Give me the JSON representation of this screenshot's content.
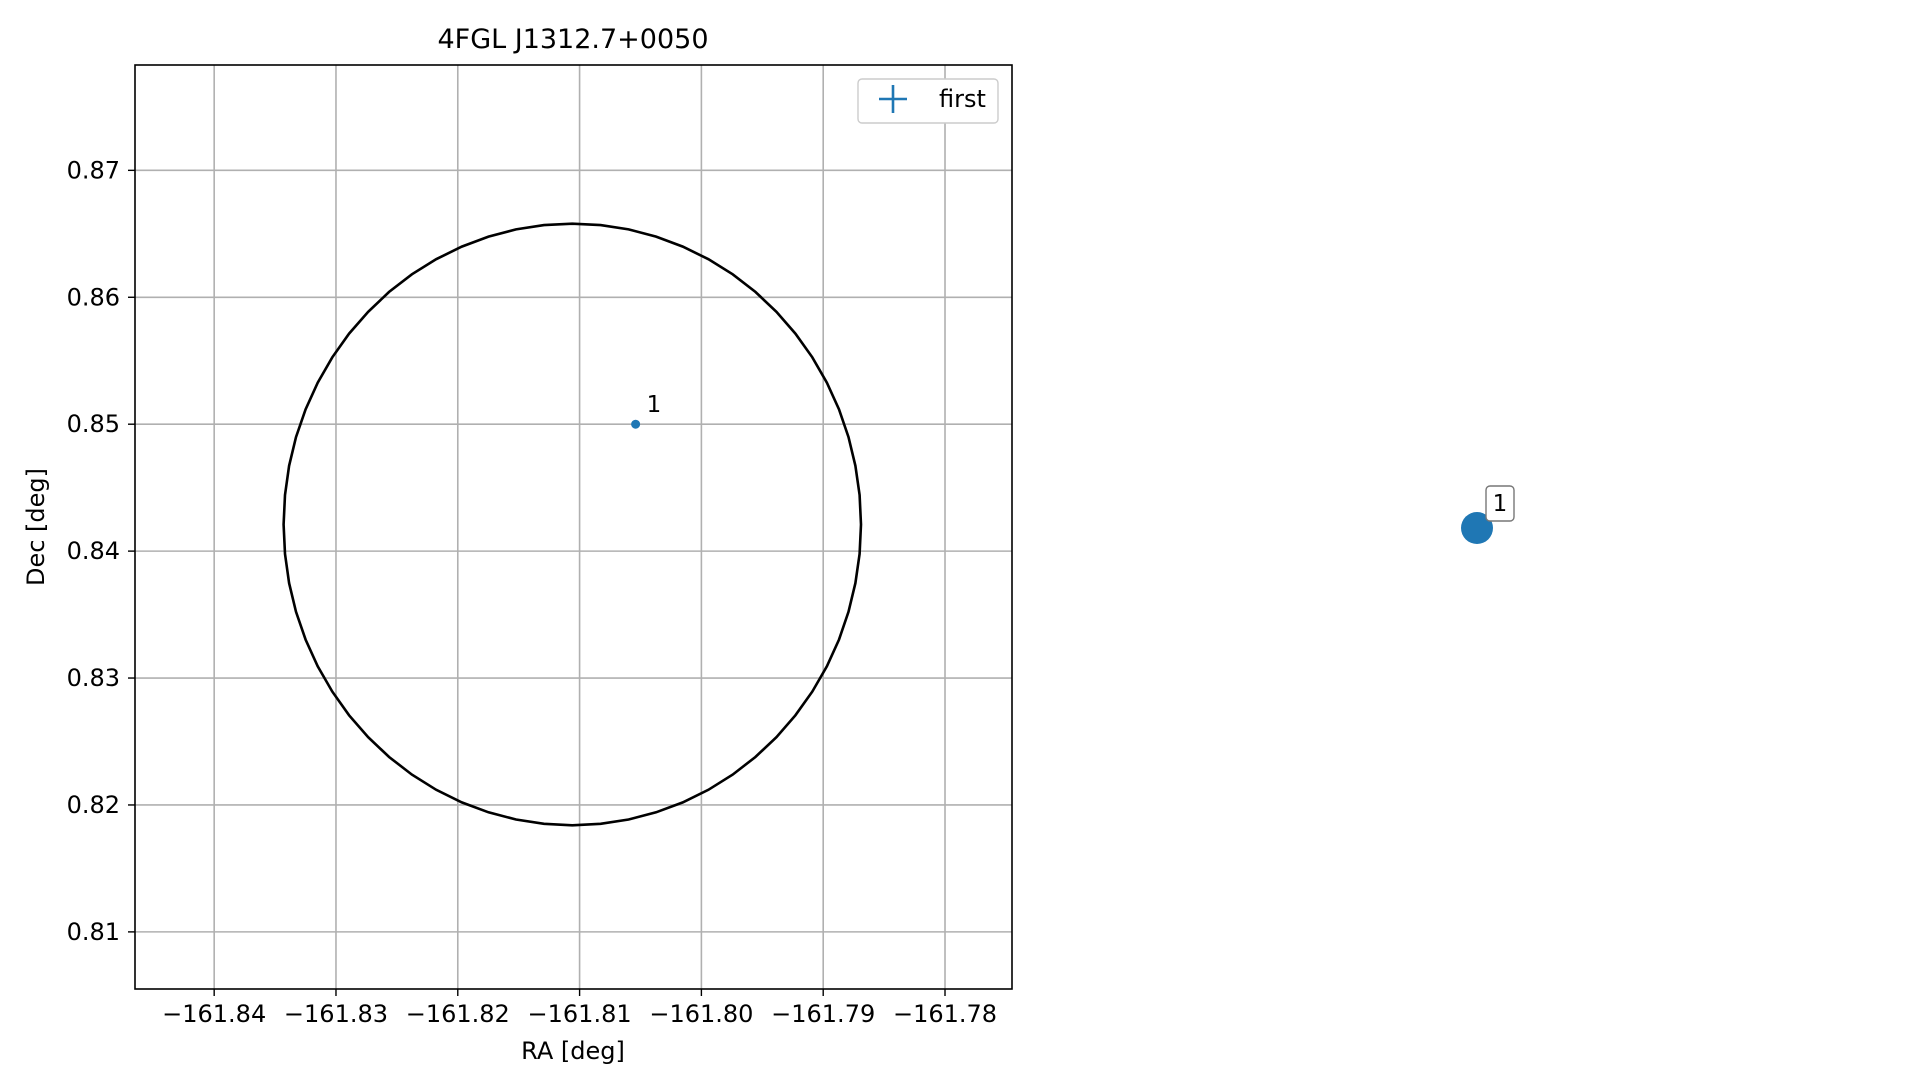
{
  "chart_data": [
    {
      "type": "scatter",
      "title": "4FGL J1312.7+0050",
      "xlabel": "RA [deg]",
      "ylabel": "Dec [deg]",
      "xlim": [
        -161.8465,
        -161.7745
      ],
      "ylim": [
        0.8055,
        0.8783
      ],
      "xticks": [
        -161.84,
        -161.83,
        -161.82,
        -161.81,
        -161.8,
        -161.79,
        -161.78
      ],
      "xtick_labels": [
        "−161.84",
        "−161.83",
        "−161.82",
        "−161.81",
        "−161.80",
        "−161.79",
        "−161.78"
      ],
      "yticks": [
        0.81,
        0.82,
        0.83,
        0.84,
        0.85,
        0.86,
        0.87
      ],
      "ytick_labels": [
        "0.81",
        "0.82",
        "0.83",
        "0.84",
        "0.85",
        "0.86",
        "0.87"
      ],
      "grid": true,
      "legend": {
        "placement": "upper right",
        "entries": [
          "first"
        ]
      },
      "series": [
        {
          "name": "first",
          "color": "#1f77b4",
          "points": [
            {
              "x": -161.8054,
              "y": 0.85,
              "label": "1"
            }
          ]
        }
      ],
      "circle": {
        "center": [
          -161.8106,
          0.8421
        ],
        "radius": 0.0237,
        "color": "#000000"
      }
    },
    {
      "type": "scatter",
      "title": "",
      "axes_visible": false,
      "points": [
        {
          "label": "1",
          "color": "#1f77b4"
        }
      ]
    }
  ]
}
